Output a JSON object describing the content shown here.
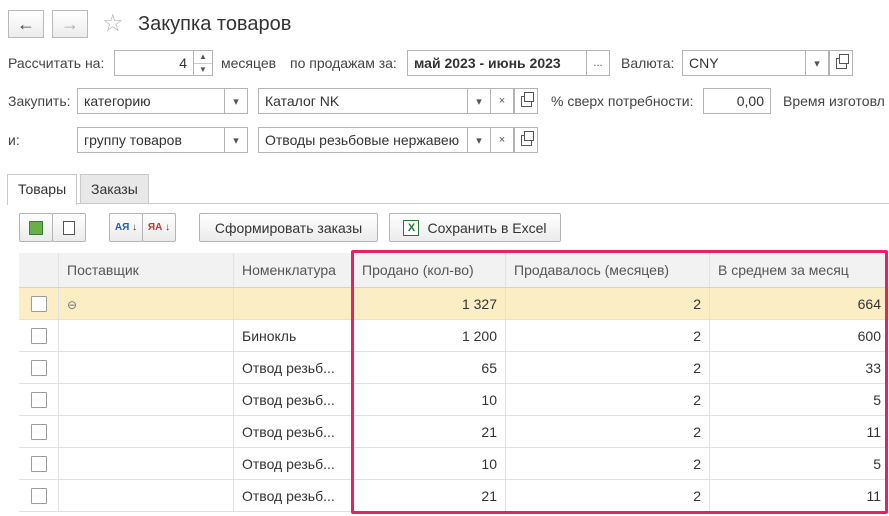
{
  "window": {
    "title": "Закупка товаров"
  },
  "nav": {
    "back": "←",
    "forward": "→",
    "star": "☆"
  },
  "form": {
    "calc_label": "Рассчитать на:",
    "calc_value": "4",
    "months_label": "месяцев",
    "by_sales_label": "по продажам за:",
    "period_value": "май 2023 - июнь 2023",
    "period_button": "...",
    "currency_label": "Валюта:",
    "currency_value": "CNY",
    "buy_label": "Закупить:",
    "buy_type_value": "категорию",
    "catalog_value": "Каталог NK",
    "percent_label": "% сверх потребности:",
    "percent_value": "0,00",
    "lead_time_label": "Время изготовл",
    "and_label": "и:",
    "group_type_value": "группу товаров",
    "group_value": "Отводы резьбовые нержавею",
    "clear_glyph": "×",
    "dropdown_glyph": "▾"
  },
  "tabs": [
    {
      "label": "Товары",
      "active": true
    },
    {
      "label": "Заказы",
      "active": false
    }
  ],
  "toolbar": {
    "sort_asc_label": "АЯ",
    "sort_desc_label": "ЯА",
    "make_orders_label": "Сформировать заказы",
    "save_excel_label": "Сохранить в Excel",
    "excel_icon_glyph": "X"
  },
  "table": {
    "columns": [
      "",
      "Поставщик",
      "Номенклатура",
      "Продано (кол-во)",
      "Продавалось (месяцев)",
      "В среднем за месяц"
    ],
    "group_row": {
      "collapse_glyph": "⊖",
      "sold": "1 327",
      "months": "2",
      "average": "664"
    },
    "rows": [
      {
        "item": "Бинокль",
        "sold": "1 200",
        "months": "2",
        "average": "600"
      },
      {
        "item": "Отвод резьб...",
        "sold": "65",
        "months": "2",
        "average": "33"
      },
      {
        "item": "Отвод резьб...",
        "sold": "10",
        "months": "2",
        "average": "5"
      },
      {
        "item": "Отвод резьб...",
        "sold": "21",
        "months": "2",
        "average": "11"
      },
      {
        "item": "Отвод резьб...",
        "sold": "10",
        "months": "2",
        "average": "5"
      },
      {
        "item": "Отвод резьб...",
        "sold": "21",
        "months": "2",
        "average": "11"
      }
    ]
  },
  "colors": {
    "highlight": "#e8225f",
    "group_row": "#fbeec4"
  }
}
